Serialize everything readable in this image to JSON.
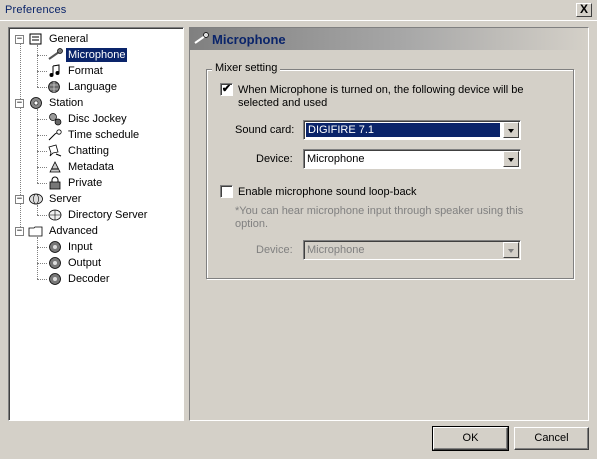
{
  "window": {
    "title": "Preferences",
    "close_label": "X"
  },
  "tree": {
    "general": "General",
    "microphone": "Microphone",
    "format": "Format",
    "language": "Language",
    "station": "Station",
    "disc_jockey": "Disc Jockey",
    "time_schedule": "Time schedule",
    "chatting": "Chatting",
    "metadata": "Metadata",
    "private": "Private",
    "server": "Server",
    "directory_server": "Directory Server",
    "advanced": "Advanced",
    "input": "Input",
    "output": "Output",
    "decoder": "Decoder",
    "expander": "−"
  },
  "panel": {
    "title": "Microphone",
    "group_label": "Mixer setting",
    "use_device_checked": "✔",
    "use_device_line1": "When Microphone is turned on, the following device will be",
    "use_device_line2": "selected and used",
    "sound_card_label": "Sound card:",
    "sound_card_value": "DIGIFIRE 7.1",
    "device_label": "Device:",
    "device_value": "Microphone",
    "loopback_label": "Enable microphone sound loop-back",
    "loopback_note_line1": "*You can hear microphone input through speaker using this",
    "loopback_note_line2": "option.",
    "loopback_device_label": "Device:",
    "loopback_device_value": "Microphone"
  },
  "buttons": {
    "ok": "OK",
    "cancel": "Cancel"
  }
}
